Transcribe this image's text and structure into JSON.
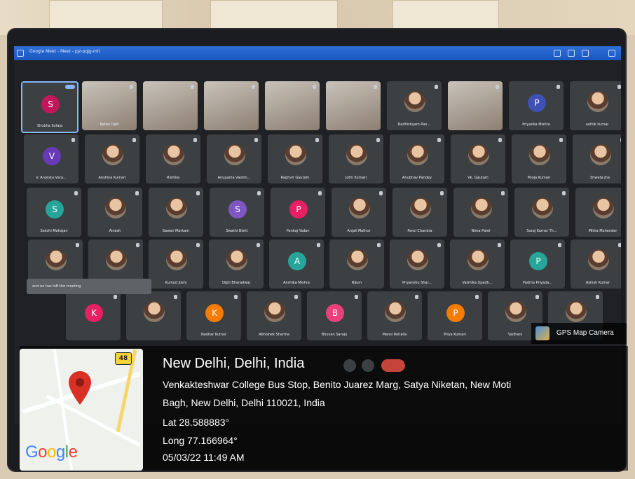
{
  "window": {
    "title": "Google Meet - Meet - pjz-pqjg-mit"
  },
  "participants": [
    {
      "name": "Shobha Sotaja",
      "initial": "S",
      "color": "#c2185b"
    },
    {
      "name": "Ketan Datt",
      "video": true
    },
    {
      "name": "",
      "video": true
    },
    {
      "name": "",
      "video": true
    },
    {
      "name": "",
      "video": true
    },
    {
      "name": "",
      "video": true
    },
    {
      "name": "Radhishyam Pan...",
      "photo": true
    },
    {
      "name": "",
      "video": true
    },
    {
      "name": "Priyanka Mishra",
      "initial": "P",
      "color": "#3f51b5"
    },
    {
      "name": "sathik kumar",
      "photo": true
    },
    {
      "name": "V. Anorata Vara...",
      "initial": "V",
      "color": "#673ab7"
    },
    {
      "name": "Anshiya Kumari",
      "photo": true
    },
    {
      "name": "Rishika",
      "photo": true
    },
    {
      "name": "Anupama Vaishn...",
      "photo": true
    },
    {
      "name": "Raghvir Gautam",
      "photo": true
    },
    {
      "name": "Jothi Kumari",
      "photo": true
    },
    {
      "name": "Anubhav Pandey",
      "photo": true
    },
    {
      "name": "Vk. Gautam",
      "photo": true
    },
    {
      "name": "Pooja Kumari",
      "photo": true
    },
    {
      "name": "Shweta Jha",
      "photo": true
    },
    {
      "name": "Sakshi Mahajan",
      "initial": "S",
      "color": "#26a69a"
    },
    {
      "name": "Ainesh",
      "photo": true
    },
    {
      "name": "Sawan Markam",
      "photo": true
    },
    {
      "name": "Swathi Bisht",
      "initial": "S",
      "color": "#7e57c2"
    },
    {
      "name": "Pankaj Yadav",
      "initial": "P",
      "color": "#e91e63"
    },
    {
      "name": "Anjali Mathur",
      "photo": true
    },
    {
      "name": "Parul Chandra",
      "photo": true
    },
    {
      "name": "Nima Patel",
      "photo": true
    },
    {
      "name": "Suraj Kumar Th...",
      "photo": true
    },
    {
      "name": "Mitha Mahender",
      "photo": true
    },
    {
      "name": "Sonali Kumari",
      "photo": true
    },
    {
      "name": "Adarsh raj",
      "photo": true
    },
    {
      "name": "Kumud Joshi",
      "photo": true
    },
    {
      "name": "Dipti Bharadwaj",
      "photo": true
    },
    {
      "name": "Anshika Mishra",
      "initial": "A",
      "color": "#26a69a"
    },
    {
      "name": "Rijum",
      "photo": true
    },
    {
      "name": "Priyanshu Shar...",
      "photo": true
    },
    {
      "name": "Vaishika Upadh...",
      "photo": true
    },
    {
      "name": "Padma Priyada...",
      "initial": "P",
      "color": "#26a69a"
    },
    {
      "name": "Ashish Kumar",
      "photo": true
    },
    {
      "name": "",
      "initial": "K",
      "color": "#e91e63"
    },
    {
      "name": "",
      "photo": true
    },
    {
      "name": "Nadhar Kumar",
      "initial": "K",
      "color": "#f57c00"
    },
    {
      "name": "Abhishek Sharma",
      "photo": true
    },
    {
      "name": "Bhuvan Saraju",
      "initial": "B",
      "color": "#ec407a"
    },
    {
      "name": "Mansi Rohalla",
      "photo": true
    },
    {
      "name": "Priya Kumari",
      "initial": "P",
      "color": "#f57c00"
    },
    {
      "name": "Vadhani",
      "photo": true
    },
    {
      "name": "",
      "photo": true
    }
  ],
  "toast": {
    "text": "and no has left the meeting"
  },
  "map": {
    "route_number": "48",
    "brand": "Google",
    "brand_colors": [
      "#4285f4",
      "#ea4335",
      "#fbbc05",
      "#4285f4",
      "#34a853",
      "#ea4335"
    ]
  },
  "location": {
    "city": "New Delhi, Delhi, India",
    "address_line1": "Venkakteshwar College Bus Stop, Benito Juarez Marg, Satya Niketan, New Moti",
    "address_line2": "Bagh, New Delhi, Delhi 110021, India",
    "lat": "Lat 28.588883°",
    "long": "Long 77.166964°",
    "datetime": "05/03/22 11:49 AM"
  },
  "app_label": "GPS Map Camera"
}
